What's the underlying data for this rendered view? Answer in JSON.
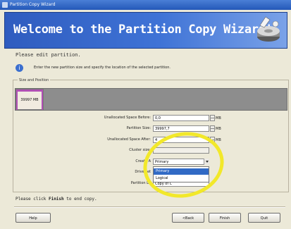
{
  "window": {
    "title": "Partition Copy Wizard"
  },
  "banner": {
    "title": "Welcome to the Partition Copy Wizard!",
    "icon": "disk-wizard-icon"
  },
  "page": {
    "subtitle": "Please edit partition.",
    "info_text": "Enter the new partition size and specify the location of the selected partition.",
    "info_icon": "info-icon"
  },
  "size_position": {
    "group_label": "Size and Position",
    "partition_label": "39997 MB"
  },
  "form": {
    "unallocated_before": {
      "label": "Unallocated Space Before:",
      "value": "0,0",
      "unit": "MB"
    },
    "partition_size": {
      "label": "Partition Size:",
      "value": "39997,7",
      "unit": "MB"
    },
    "unallocated_after": {
      "label": "Unallocated Space After:",
      "value": "4",
      "unit": "MB"
    },
    "cluster_size": {
      "label": "Cluster size:"
    },
    "create_as": {
      "label": "Create A",
      "value": "Primary"
    },
    "drive_letter": {
      "label": "Drive Let"
    },
    "partition_label": {
      "label": "Partition La",
      "value": "Copy of C"
    }
  },
  "create_as_options": [
    "Primary",
    "Logical"
  ],
  "footer": {
    "prefix": "Please click ",
    "bold": "Finish",
    "suffix": " to end copy."
  },
  "buttons": {
    "help": "Help",
    "back": "<Back",
    "finish": "Finish",
    "quit": "Quit"
  },
  "colors": {
    "banner": "#3f73d6",
    "highlight": "#f2e82a",
    "selection": "#316ac5",
    "partition_border": "#b04fb4"
  }
}
